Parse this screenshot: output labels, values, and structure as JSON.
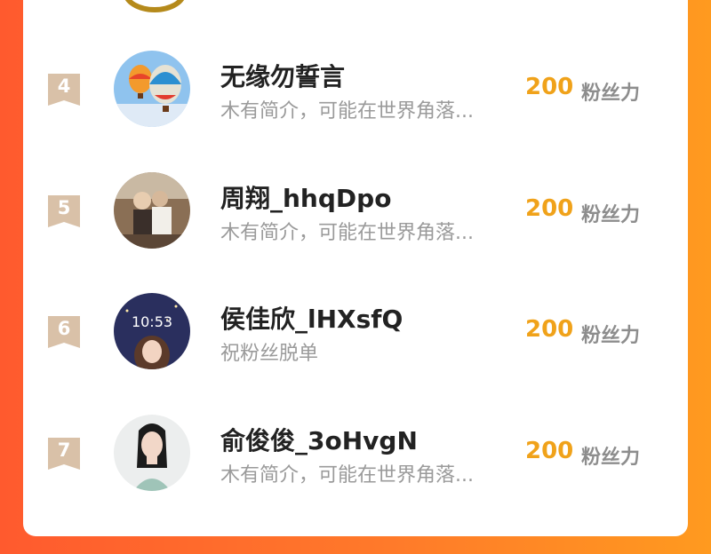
{
  "colors": {
    "background_gradient": [
      "#ff5a2e",
      "#ff9a1f"
    ],
    "card": "#ffffff",
    "count": "#f0a21a",
    "badge": "#d9c1a8"
  },
  "ranking": {
    "fans_unit": "粉丝力",
    "rows": [
      {
        "rank": "4",
        "name": "无缘勿誓言",
        "bio": "木有简介，可能在世界角落...",
        "count": "200",
        "avatar": "hot-air-balloons-avatar"
      },
      {
        "rank": "5",
        "name": "周翔_hhqDpo",
        "bio": "木有简介，可能在世界角落...",
        "count": "200",
        "avatar": "couple-photo-avatar"
      },
      {
        "rank": "6",
        "name": "侯佳欣_lHXsfQ",
        "bio": "祝粉丝脱单",
        "count": "200",
        "avatar": "lockscreen-girl-avatar"
      },
      {
        "rank": "7",
        "name": "俞俊俊_3oHvgN",
        "bio": "木有简介，可能在世界角落...",
        "count": "200",
        "avatar": "woman-portrait-avatar"
      }
    ]
  }
}
